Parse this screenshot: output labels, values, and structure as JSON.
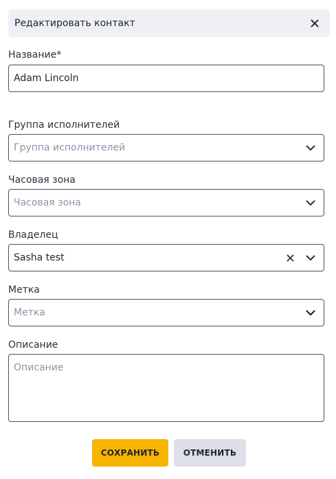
{
  "dialog": {
    "title": "Редактировать контакт"
  },
  "form": {
    "name": {
      "label": "Название*",
      "value": "Adam Lincoln"
    },
    "group": {
      "label": "Группа исполнителей",
      "placeholder": "Группа исполнителей"
    },
    "timezone": {
      "label": "Часовая зона",
      "placeholder": "Часовая зона"
    },
    "owner": {
      "label": "Владелец",
      "value": "Sasha test"
    },
    "tag": {
      "label": "Метка",
      "placeholder": "Метка"
    },
    "description": {
      "label": "Описание",
      "placeholder": "Описание"
    }
  },
  "actions": {
    "save_label": "СОХРАНИТЬ",
    "cancel_label": "ОТМЕНИТЬ"
  },
  "colors": {
    "accent": "#f7b500",
    "header_bg": "#eef0f5",
    "cancel_bg": "#dde0e7"
  },
  "icons": {
    "close": "close-icon",
    "dropdown": "chevron-down-icon",
    "clear": "clear-icon"
  }
}
